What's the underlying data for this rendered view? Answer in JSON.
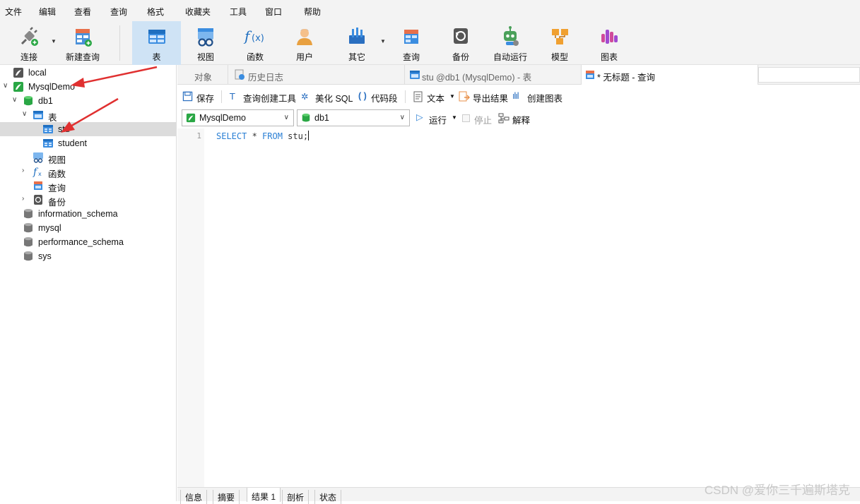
{
  "menu": [
    "文件",
    "编辑",
    "查看",
    "查询",
    "格式",
    "收藏夹",
    "工具",
    "窗口",
    "帮助"
  ],
  "toolbar": {
    "connect": "连接",
    "new_query": "新建查询",
    "table": "表",
    "view": "视图",
    "function": "函数",
    "user": "用户",
    "other": "其它",
    "query": "查询",
    "backup": "备份",
    "auto_run": "自动运行",
    "model": "模型",
    "chart": "图表"
  },
  "tree": [
    {
      "label": "local",
      "icon": "connection-icon"
    },
    {
      "label": "MysqlDemo",
      "icon": "connection-active-icon"
    },
    {
      "label": "db1",
      "icon": "database-icon"
    },
    {
      "label": "表",
      "icon": "table-folder-icon"
    },
    {
      "label": "stu",
      "icon": "table-icon"
    },
    {
      "label": "student",
      "icon": "table-icon"
    },
    {
      "label": "视图",
      "icon": "view-icon"
    },
    {
      "label": "函数",
      "icon": "function-icon"
    },
    {
      "label": "查询",
      "icon": "query-icon"
    },
    {
      "label": "备份",
      "icon": "backup-icon"
    },
    {
      "label": "information_schema",
      "icon": "database-grey-icon"
    },
    {
      "label": "mysql",
      "icon": "database-grey-icon"
    },
    {
      "label": "performance_schema",
      "icon": "database-grey-icon"
    },
    {
      "label": "sys",
      "icon": "database-grey-icon"
    }
  ],
  "tabs": {
    "objects": "对象",
    "history": "历史日志",
    "table_tab": "stu @db1 (MysqlDemo) - 表",
    "query_tab": "* 无标题 - 查询"
  },
  "query_toolbar": {
    "save": "保存",
    "builder": "查询创建工具",
    "beautify": "美化 SQL",
    "snippet": "代码段",
    "text": "文本",
    "export": "导出结果",
    "create_chart": "创建图表"
  },
  "selectors": {
    "connection": "MysqlDemo",
    "database": "db1",
    "run": "运行",
    "stop": "停止",
    "explain": "解释"
  },
  "editor": {
    "line_number": "1",
    "kw_select": "SELECT",
    "mid": " * ",
    "kw_from": "FROM",
    "rest": " stu;"
  },
  "bottom_tabs": [
    "信息",
    "摘要",
    "结果 1",
    "剖析",
    "状态"
  ],
  "watermark": "CSDN @爱你三千遍斯塔克",
  "colors": {
    "accent": "#2a7fd4",
    "active_tab": "#cfe3f5",
    "arrow": "#e03030"
  }
}
